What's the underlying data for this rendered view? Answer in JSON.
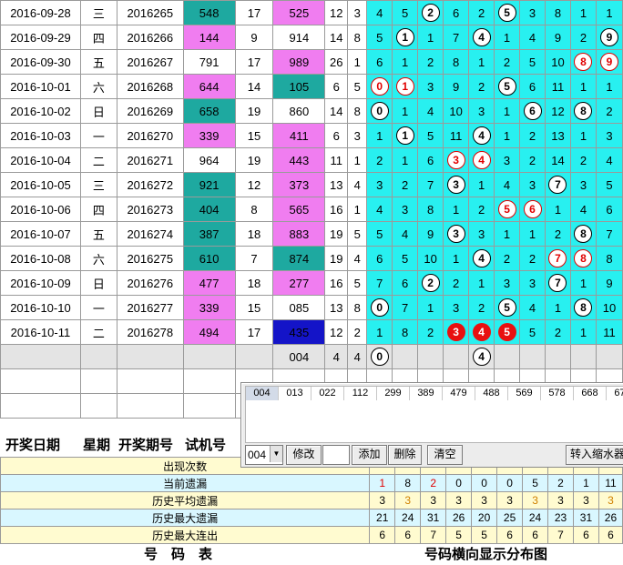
{
  "rows": [
    {
      "date": "2016-09-28",
      "week": "三",
      "period": "2016265",
      "trial": "548",
      "trial_color": "teal",
      "sum": "17",
      "draw": "525",
      "draw_color": "pink",
      "span": "12",
      "num": "3",
      "cells": [
        {
          "v": "4"
        },
        {
          "v": "5"
        },
        {
          "v": "2",
          "s": "w"
        },
        {
          "v": "6"
        },
        {
          "v": "2"
        },
        {
          "v": "5",
          "s": "w"
        },
        {
          "v": "3"
        },
        {
          "v": "8"
        },
        {
          "v": "1"
        },
        {
          "v": "1"
        }
      ]
    },
    {
      "date": "2016-09-29",
      "week": "四",
      "period": "2016266",
      "trial": "144",
      "trial_color": "pink",
      "sum": "9",
      "draw": "914",
      "draw_color": "white",
      "span": "14",
      "num": "8",
      "cells": [
        {
          "v": "5"
        },
        {
          "v": "1",
          "s": "w"
        },
        {
          "v": "1"
        },
        {
          "v": "7"
        },
        {
          "v": "4",
          "s": "w"
        },
        {
          "v": "1"
        },
        {
          "v": "4"
        },
        {
          "v": "9"
        },
        {
          "v": "2"
        },
        {
          "v": "9",
          "s": "w"
        }
      ]
    },
    {
      "date": "2016-09-30",
      "week": "五",
      "period": "2016267",
      "trial": "791",
      "trial_color": "white",
      "sum": "17",
      "draw": "989",
      "draw_color": "pink",
      "span": "26",
      "num": "1",
      "cells": [
        {
          "v": "6"
        },
        {
          "v": "1"
        },
        {
          "v": "2"
        },
        {
          "v": "8"
        },
        {
          "v": "1"
        },
        {
          "v": "2"
        },
        {
          "v": "5"
        },
        {
          "v": "10"
        },
        {
          "v": "8",
          "s": "r"
        },
        {
          "v": "9",
          "s": "r"
        }
      ]
    },
    {
      "date": "2016-10-01",
      "week": "六",
      "period": "2016268",
      "trial": "644",
      "trial_color": "pink",
      "sum": "14",
      "draw": "105",
      "draw_color": "teal",
      "span": "6",
      "num": "5",
      "cells": [
        {
          "v": "0",
          "s": "r"
        },
        {
          "v": "1",
          "s": "r"
        },
        {
          "v": "3"
        },
        {
          "v": "9"
        },
        {
          "v": "2"
        },
        {
          "v": "5",
          "s": "w"
        },
        {
          "v": "6"
        },
        {
          "v": "11"
        },
        {
          "v": "1"
        },
        {
          "v": "1"
        }
      ]
    },
    {
      "date": "2016-10-02",
      "week": "日",
      "period": "2016269",
      "trial": "658",
      "trial_color": "teal",
      "sum": "19",
      "draw": "860",
      "draw_color": "white",
      "span": "14",
      "num": "8",
      "cells": [
        {
          "v": "0",
          "s": "w"
        },
        {
          "v": "1"
        },
        {
          "v": "4"
        },
        {
          "v": "10"
        },
        {
          "v": "3"
        },
        {
          "v": "1"
        },
        {
          "v": "6",
          "s": "w"
        },
        {
          "v": "12"
        },
        {
          "v": "8",
          "s": "w"
        },
        {
          "v": "2"
        }
      ]
    },
    {
      "date": "2016-10-03",
      "week": "一",
      "period": "2016270",
      "trial": "339",
      "trial_color": "pink",
      "sum": "15",
      "draw": "411",
      "draw_color": "pink",
      "span": "6",
      "num": "3",
      "cells": [
        {
          "v": "1"
        },
        {
          "v": "1",
          "s": "w"
        },
        {
          "v": "5"
        },
        {
          "v": "11"
        },
        {
          "v": "4",
          "s": "w"
        },
        {
          "v": "1"
        },
        {
          "v": "2"
        },
        {
          "v": "13"
        },
        {
          "v": "1"
        },
        {
          "v": "3"
        }
      ]
    },
    {
      "date": "2016-10-04",
      "week": "二",
      "period": "2016271",
      "trial": "964",
      "trial_color": "white",
      "sum": "19",
      "draw": "443",
      "draw_color": "pink",
      "span": "11",
      "num": "1",
      "cells": [
        {
          "v": "2"
        },
        {
          "v": "1"
        },
        {
          "v": "6"
        },
        {
          "v": "3",
          "s": "r"
        },
        {
          "v": "4",
          "s": "r"
        },
        {
          "v": "3"
        },
        {
          "v": "2"
        },
        {
          "v": "14"
        },
        {
          "v": "2"
        },
        {
          "v": "4"
        }
      ]
    },
    {
      "date": "2016-10-05",
      "week": "三",
      "period": "2016272",
      "trial": "921",
      "trial_color": "teal",
      "sum": "12",
      "draw": "373",
      "draw_color": "pink",
      "span": "13",
      "num": "4",
      "cells": [
        {
          "v": "3"
        },
        {
          "v": "2"
        },
        {
          "v": "7"
        },
        {
          "v": "3",
          "s": "w"
        },
        {
          "v": "1"
        },
        {
          "v": "4"
        },
        {
          "v": "3"
        },
        {
          "v": "7",
          "s": "w"
        },
        {
          "v": "3"
        },
        {
          "v": "5"
        }
      ]
    },
    {
      "date": "2016-10-06",
      "week": "四",
      "period": "2016273",
      "trial": "404",
      "trial_color": "teal",
      "sum": "8",
      "draw": "565",
      "draw_color": "pink",
      "span": "16",
      "num": "1",
      "cells": [
        {
          "v": "4"
        },
        {
          "v": "3"
        },
        {
          "v": "8"
        },
        {
          "v": "1"
        },
        {
          "v": "2"
        },
        {
          "v": "5",
          "s": "r"
        },
        {
          "v": "6",
          "s": "r"
        },
        {
          "v": "1"
        },
        {
          "v": "4"
        },
        {
          "v": "6"
        }
      ]
    },
    {
      "date": "2016-10-07",
      "week": "五",
      "period": "2016274",
      "trial": "387",
      "trial_color": "teal",
      "sum": "18",
      "draw": "883",
      "draw_color": "pink",
      "span": "19",
      "num": "5",
      "cells": [
        {
          "v": "5"
        },
        {
          "v": "4"
        },
        {
          "v": "9"
        },
        {
          "v": "3",
          "s": "w"
        },
        {
          "v": "3"
        },
        {
          "v": "1"
        },
        {
          "v": "1"
        },
        {
          "v": "2"
        },
        {
          "v": "8",
          "s": "w"
        },
        {
          "v": "7"
        }
      ]
    },
    {
      "date": "2016-10-08",
      "week": "六",
      "period": "2016275",
      "trial": "610",
      "trial_color": "teal",
      "sum": "7",
      "draw": "874",
      "draw_color": "teal",
      "span": "19",
      "num": "4",
      "cells": [
        {
          "v": "6"
        },
        {
          "v": "5"
        },
        {
          "v": "10"
        },
        {
          "v": "1"
        },
        {
          "v": "4",
          "s": "w"
        },
        {
          "v": "2"
        },
        {
          "v": "2"
        },
        {
          "v": "7",
          "s": "r"
        },
        {
          "v": "8",
          "s": "r"
        },
        {
          "v": "8"
        }
      ]
    },
    {
      "date": "2016-10-09",
      "week": "日",
      "period": "2016276",
      "trial": "477",
      "trial_color": "pink",
      "sum": "18",
      "draw": "277",
      "draw_color": "pink",
      "span": "16",
      "num": "5",
      "cells": [
        {
          "v": "7"
        },
        {
          "v": "6"
        },
        {
          "v": "2",
          "s": "w"
        },
        {
          "v": "2"
        },
        {
          "v": "1"
        },
        {
          "v": "3"
        },
        {
          "v": "3"
        },
        {
          "v": "7",
          "s": "w"
        },
        {
          "v": "1"
        },
        {
          "v": "9"
        }
      ]
    },
    {
      "date": "2016-10-10",
      "week": "一",
      "period": "2016277",
      "trial": "339",
      "trial_color": "pink",
      "sum": "15",
      "draw": "085",
      "draw_color": "white",
      "span": "13",
      "num": "8",
      "cells": [
        {
          "v": "0",
          "s": "w"
        },
        {
          "v": "7"
        },
        {
          "v": "1"
        },
        {
          "v": "3"
        },
        {
          "v": "2"
        },
        {
          "v": "5",
          "s": "w"
        },
        {
          "v": "4"
        },
        {
          "v": "1"
        },
        {
          "v": "8",
          "s": "w"
        },
        {
          "v": "10"
        }
      ]
    },
    {
      "date": "2016-10-11",
      "week": "二",
      "period": "2016278",
      "trial": "494",
      "trial_color": "pink",
      "sum": "17",
      "draw": "435",
      "draw_color": "blue",
      "span": "12",
      "num": "2",
      "cells": [
        {
          "v": "1"
        },
        {
          "v": "8"
        },
        {
          "v": "2"
        },
        {
          "v": "3",
          "s": "f"
        },
        {
          "v": "4",
          "s": "f"
        },
        {
          "v": "5",
          "s": "f"
        },
        {
          "v": "5"
        },
        {
          "v": "2"
        },
        {
          "v": "1"
        },
        {
          "v": "11"
        }
      ]
    }
  ],
  "pending_row": {
    "draw": "004",
    "span": "4",
    "num": "4",
    "cells": [
      {
        "v": "0",
        "s": "w"
      },
      {
        "v": ""
      },
      {
        "v": ""
      },
      {
        "v": ""
      },
      {
        "v": "4",
        "s": "w"
      },
      {
        "v": ""
      },
      {
        "v": ""
      },
      {
        "v": ""
      },
      {
        "v": ""
      },
      {
        "v": ""
      }
    ]
  },
  "header": {
    "date": "开奖日期",
    "week": "星期",
    "period": "开奖期号",
    "trial": "试机号"
  },
  "panel": {
    "tabs": [
      "004",
      "013",
      "022",
      "112",
      "299",
      "389",
      "479",
      "488",
      "569",
      "578",
      "668",
      "677"
    ],
    "combo_value": "004",
    "modify": "修改",
    "add": "添加",
    "delete": "删除",
    "clear": "清空",
    "transfer": "转入缩水器"
  },
  "stats": [
    {
      "label": "出现次数",
      "values": [
        "",
        "",
        "",
        "",
        "",
        "",
        "",
        "",
        "",
        ""
      ]
    },
    {
      "label": "当前遗漏",
      "values": [
        "1",
        "8",
        "2",
        "0",
        "0",
        "0",
        "5",
        "2",
        "1",
        "11"
      ],
      "red": [
        0,
        2
      ]
    },
    {
      "label": "历史平均遗漏",
      "values": [
        "3",
        "3",
        "3",
        "3",
        "3",
        "3",
        "3",
        "3",
        "3",
        "3"
      ],
      "red": [
        1,
        6,
        9
      ]
    },
    {
      "label": "历史最大遗漏",
      "values": [
        "21",
        "24",
        "31",
        "26",
        "20",
        "25",
        "24",
        "23",
        "31",
        "26"
      ]
    },
    {
      "label": "历史最大连出",
      "values": [
        "6",
        "6",
        "7",
        "5",
        "5",
        "6",
        "6",
        "7",
        "6",
        "6"
      ]
    }
  ],
  "footer": {
    "left": "号　码　表",
    "right": "号码横向显示分布图"
  },
  "colors": {
    "teal": "#1ea9a0",
    "pink": "#f07df0",
    "cyan": "#28f0f0",
    "blue": "#1414c8",
    "red": "#e81010"
  }
}
